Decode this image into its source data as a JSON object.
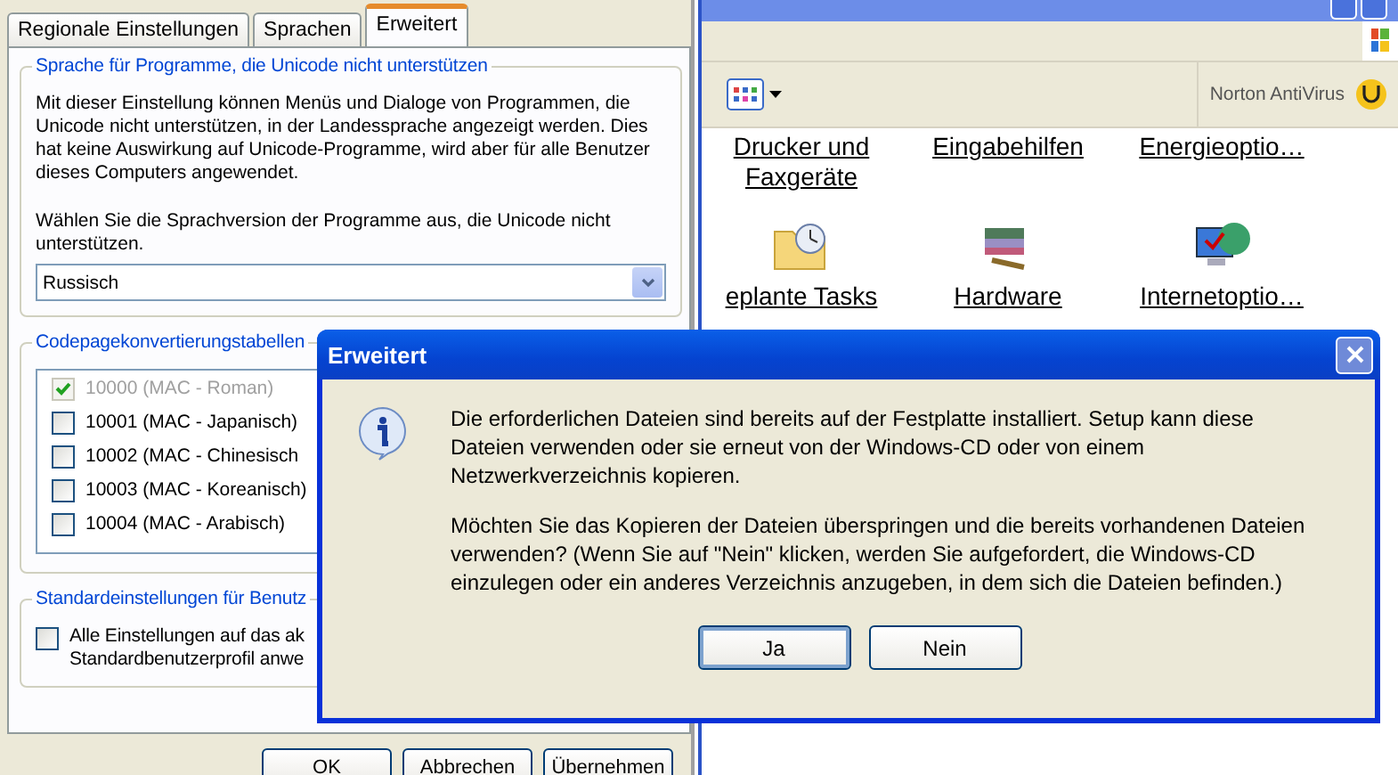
{
  "settings_window": {
    "tabs": [
      {
        "label": "Regionale Einstellungen",
        "selected": false
      },
      {
        "label": "Sprachen",
        "selected": false
      },
      {
        "label": "Erweitert",
        "selected": true
      }
    ],
    "unicode_group": {
      "title": "Sprache für Programme, die Unicode nicht unterstützen",
      "description": "Mit dieser Einstellung können Menüs und Dialoge von Programmen, die Unicode nicht unterstützen, in der Landessprache angezeigt werden. Dies hat keine Auswirkung auf Unicode-Programme, wird aber für alle Benutzer dieses Computers angewendet.",
      "prompt": "Wählen Sie die Sprachversion der Programme aus, die Unicode nicht unterstützen.",
      "language_select": {
        "value": "Russisch"
      }
    },
    "codepage_group": {
      "title": "Codepagekonvertierungstabellen",
      "items": [
        {
          "label": "10000 (MAC - Roman)",
          "checked": true,
          "disabled": true
        },
        {
          "label": "10001 (MAC - Japanisch)",
          "checked": false,
          "disabled": false
        },
        {
          "label": "10002 (MAC - Chinesisch",
          "checked": false,
          "disabled": false
        },
        {
          "label": "10003 (MAC - Koreanisch)",
          "checked": false,
          "disabled": false
        },
        {
          "label": "10004 (MAC - Arabisch)",
          "checked": false,
          "disabled": false
        }
      ]
    },
    "defaults_group": {
      "title": "Standardeinstellungen für Benutz",
      "checkbox": {
        "label_lines": [
          "Alle Einstellungen auf das ak",
          "Standardbenutzerprofil anwe"
        ],
        "checked": false
      }
    },
    "buttons": [
      "OK",
      "Abbrechen",
      "Übernehmen"
    ]
  },
  "control_panel": {
    "norton_label": "Norton AntiVirus",
    "rows": [
      {
        "items": [
          {
            "label": "Drucker und Faxgeräte"
          },
          {
            "label": "Eingabehilfen"
          },
          {
            "label": "Energieoptio…"
          }
        ]
      },
      {
        "items": [
          {
            "label": "eplante Tasks"
          },
          {
            "label": "Hardware"
          },
          {
            "label": "Internetoptio…"
          }
        ]
      }
    ]
  },
  "dialog": {
    "title": "Erweitert",
    "paragraphs": [
      "Die erforderlichen Dateien sind bereits auf der Festplatte installiert. Setup kann diese Dateien verwenden oder sie erneut von der Windows-CD oder von einem Netzwerkverzeichnis kopieren.",
      "Möchten Sie das Kopieren der Dateien überspringen und die bereits vorhandenen Dateien verwenden? (Wenn Sie auf \"Nein\" klicken, werden Sie aufgefordert, die Windows-CD einzulegen oder ein anderes Verzeichnis anzugeben, in dem sich die Dateien befinden.)"
    ],
    "buttons": [
      {
        "label": "Ja",
        "focused": true
      },
      {
        "label": "Nein",
        "focused": false
      }
    ]
  }
}
